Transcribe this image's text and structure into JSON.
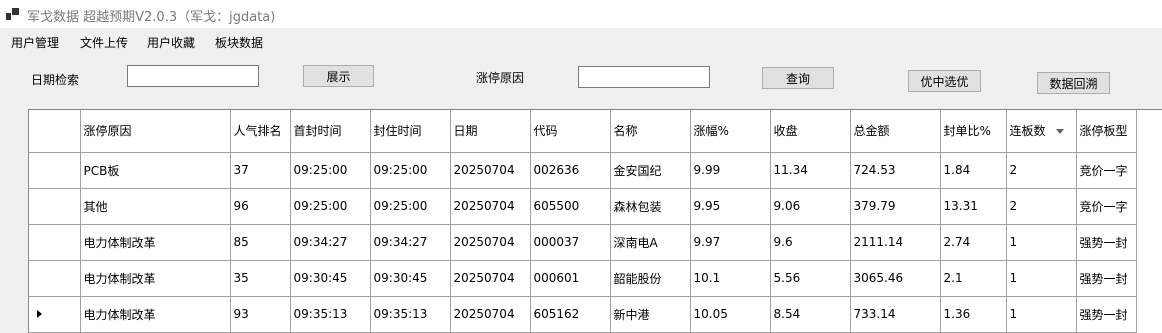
{
  "window": {
    "title": "军戈数据 超越预期V2.0.3（军戈：jgdata)"
  },
  "menu": [
    "用户管理",
    "文件上传",
    "用户收藏",
    "板块数据"
  ],
  "toolbar": {
    "date_label": "日期检索",
    "date_value": "",
    "show_button": "展示",
    "reason_label": "涨停原因",
    "reason_value": "",
    "query_button": "查询",
    "pick_button": "优中选优",
    "backtest_button": "数据回溯"
  },
  "table": {
    "columns": [
      "涨停原因",
      "人气排名",
      "首封时间",
      "封住时间",
      "日期",
      "代码",
      "名称",
      "涨幅%",
      "收盘",
      "总金额",
      "封单比%",
      "连板数",
      "涨停板型"
    ],
    "rows": [
      [
        "PCB板",
        "37",
        "09:25:00",
        "09:25:00",
        "20250704",
        "002636",
        "金安国纪",
        "9.99",
        "11.34",
        "724.53",
        "1.84",
        "2",
        "竞价一字"
      ],
      [
        "其他",
        "96",
        "09:25:00",
        "09:25:00",
        "20250704",
        "605500",
        "森林包装",
        "9.95",
        "9.06",
        "379.79",
        "13.31",
        "2",
        "竞价一字"
      ],
      [
        "电力体制改革",
        "85",
        "09:34:27",
        "09:34:27",
        "20250704",
        "000037",
        "深南电A",
        "9.97",
        "9.6",
        "2111.14",
        "2.74",
        "1",
        "强势一封"
      ],
      [
        "电力体制改革",
        "35",
        "09:30:45",
        "09:30:45",
        "20250704",
        "000601",
        "韶能股份",
        "10.1",
        "5.56",
        "3065.46",
        "2.1",
        "1",
        "强势一封"
      ],
      [
        "电力体制改革",
        "93",
        "09:35:13",
        "09:35:13",
        "20250704",
        "605162",
        "新中港",
        "10.05",
        "8.54",
        "733.14",
        "1.36",
        "1",
        "强势一封"
      ]
    ],
    "sorted_column": "连板数",
    "current_row": 4
  }
}
